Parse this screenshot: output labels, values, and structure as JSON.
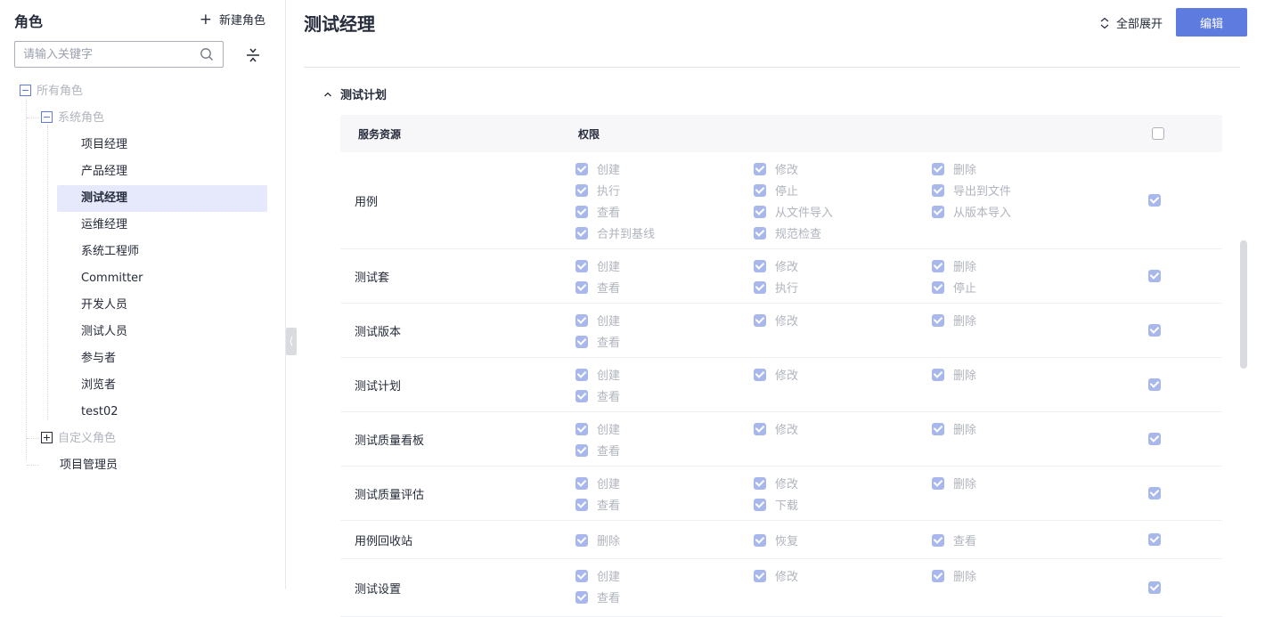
{
  "sidebar": {
    "title": "角色",
    "new_role": "新建角色",
    "search_placeholder": "请输入关键字",
    "tree": {
      "all_roles": "所有角色",
      "system_roles": "系统角色",
      "system_children": [
        "项目经理",
        "产品经理",
        "测试经理",
        "运维经理",
        "系统工程师",
        "Committer",
        "开发人员",
        "测试人员",
        "参与者",
        "浏览者",
        "test02"
      ],
      "selected": "测试经理",
      "custom_roles": "自定义角色",
      "project_admin": "项目管理员"
    }
  },
  "header": {
    "title": "测试经理",
    "expand_all": "全部展开",
    "edit": "编辑"
  },
  "section": {
    "title": "测试计划",
    "col_resource": "服务资源",
    "col_permission": "权限",
    "rows": [
      {
        "name": "用例",
        "perms": [
          "创建",
          "修改",
          "删除",
          "执行",
          "停止",
          "导出到文件",
          "查看",
          "从文件导入",
          "从版本导入",
          "合并到基线",
          "规范检查"
        ]
      },
      {
        "name": "测试套",
        "perms": [
          "创建",
          "修改",
          "删除",
          "查看",
          "执行",
          "停止"
        ]
      },
      {
        "name": "测试版本",
        "perms": [
          "创建",
          "修改",
          "删除",
          "查看"
        ]
      },
      {
        "name": "测试计划",
        "perms": [
          "创建",
          "修改",
          "删除",
          "查看"
        ]
      },
      {
        "name": "测试质量看板",
        "perms": [
          "创建",
          "修改",
          "删除",
          "查看"
        ]
      },
      {
        "name": "测试质量评估",
        "perms": [
          "创建",
          "修改",
          "删除",
          "查看",
          "下载"
        ]
      },
      {
        "name": "用例回收站",
        "perms": [
          "删除",
          "恢复",
          "查看"
        ]
      },
      {
        "name": "测试设置",
        "perms": [
          "创建",
          "修改",
          "删除",
          "查看"
        ]
      }
    ]
  },
  "colors": {
    "accent": "#5e7ce0",
    "selected_bg": "#e6e9fb",
    "checkbox_checked": "#a9b8ec",
    "muted_text": "#b0b4bd"
  }
}
